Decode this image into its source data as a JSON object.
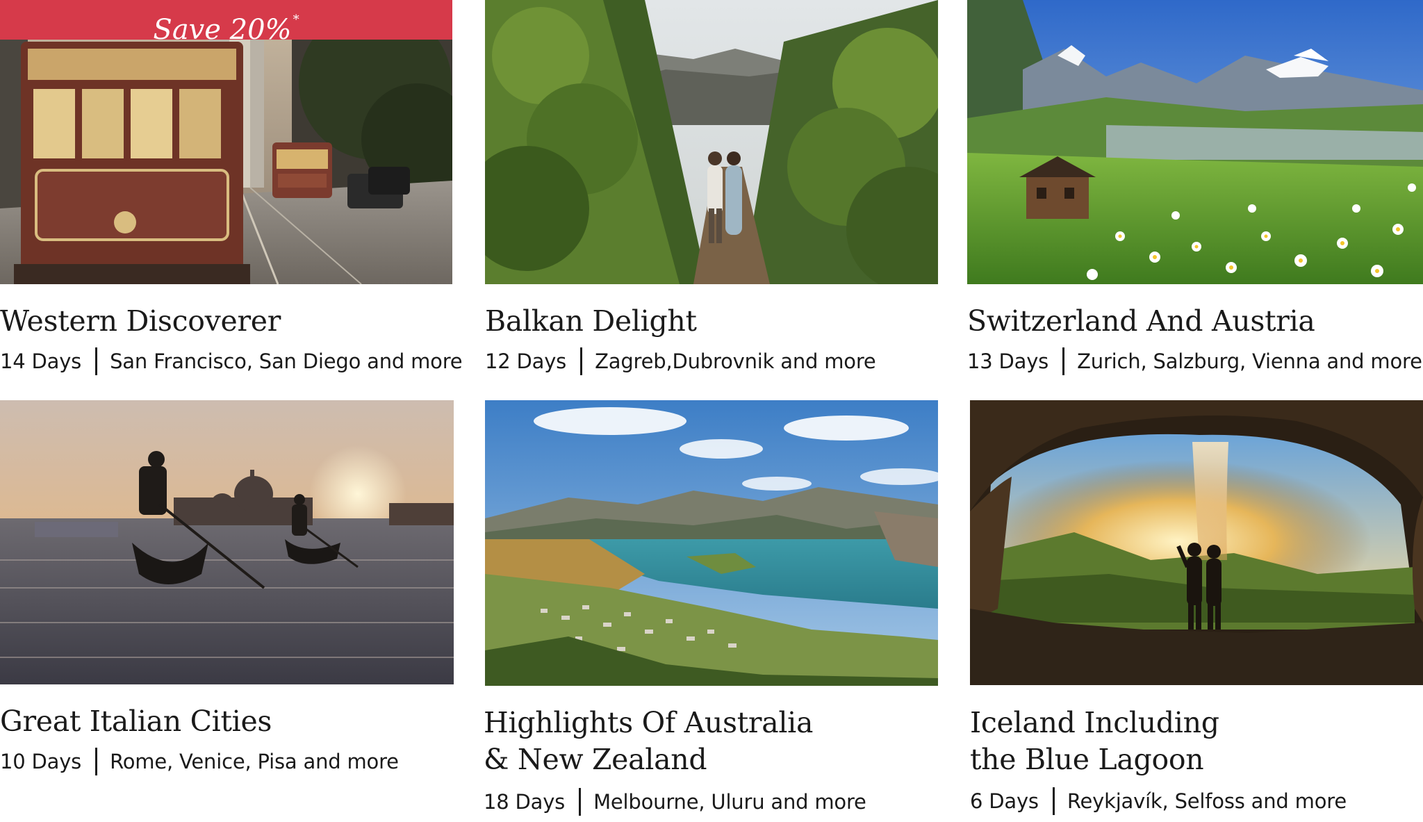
{
  "tours": [
    {
      "badge": "Save 20%",
      "badge_mark": "*",
      "title_line1": "Western Discoverer",
      "title_line2": "",
      "days": "14 Days",
      "places": "San Francisco, San Diego and more",
      "image": "cable-car-street"
    },
    {
      "title_line1": "Balkan Delight",
      "title_line2": "",
      "days": "12 Days",
      "places": "Zagreb,Dubrovnik and more",
      "image": "vineyard-couple"
    },
    {
      "title_line1": "Switzerland And Austria",
      "title_line2": "",
      "days": "13 Days",
      "places": "Zurich, Salzburg, Vienna and more",
      "image": "alpine-meadow-chalet"
    },
    {
      "title_line1": "Great Italian Cities",
      "title_line2": "",
      "days": "10 Days",
      "places": "Rome, Venice, Pisa and more",
      "image": "venice-gondolas-sunset"
    },
    {
      "title_line1": "Highlights Of Australia",
      "title_line2": "& New Zealand",
      "days": "18 Days",
      "places": "Melbourne, Uluru and more",
      "image": "queenstown-lake"
    },
    {
      "title_line1": "Iceland Including",
      "title_line2": "the Blue Lagoon",
      "days": "6 Days",
      "places": "Reykjavík, Selfoss and more",
      "image": "waterfall-cave-couple"
    }
  ],
  "colors": {
    "badge_bg": "#d63a4a",
    "text": "#1a1a1a"
  }
}
